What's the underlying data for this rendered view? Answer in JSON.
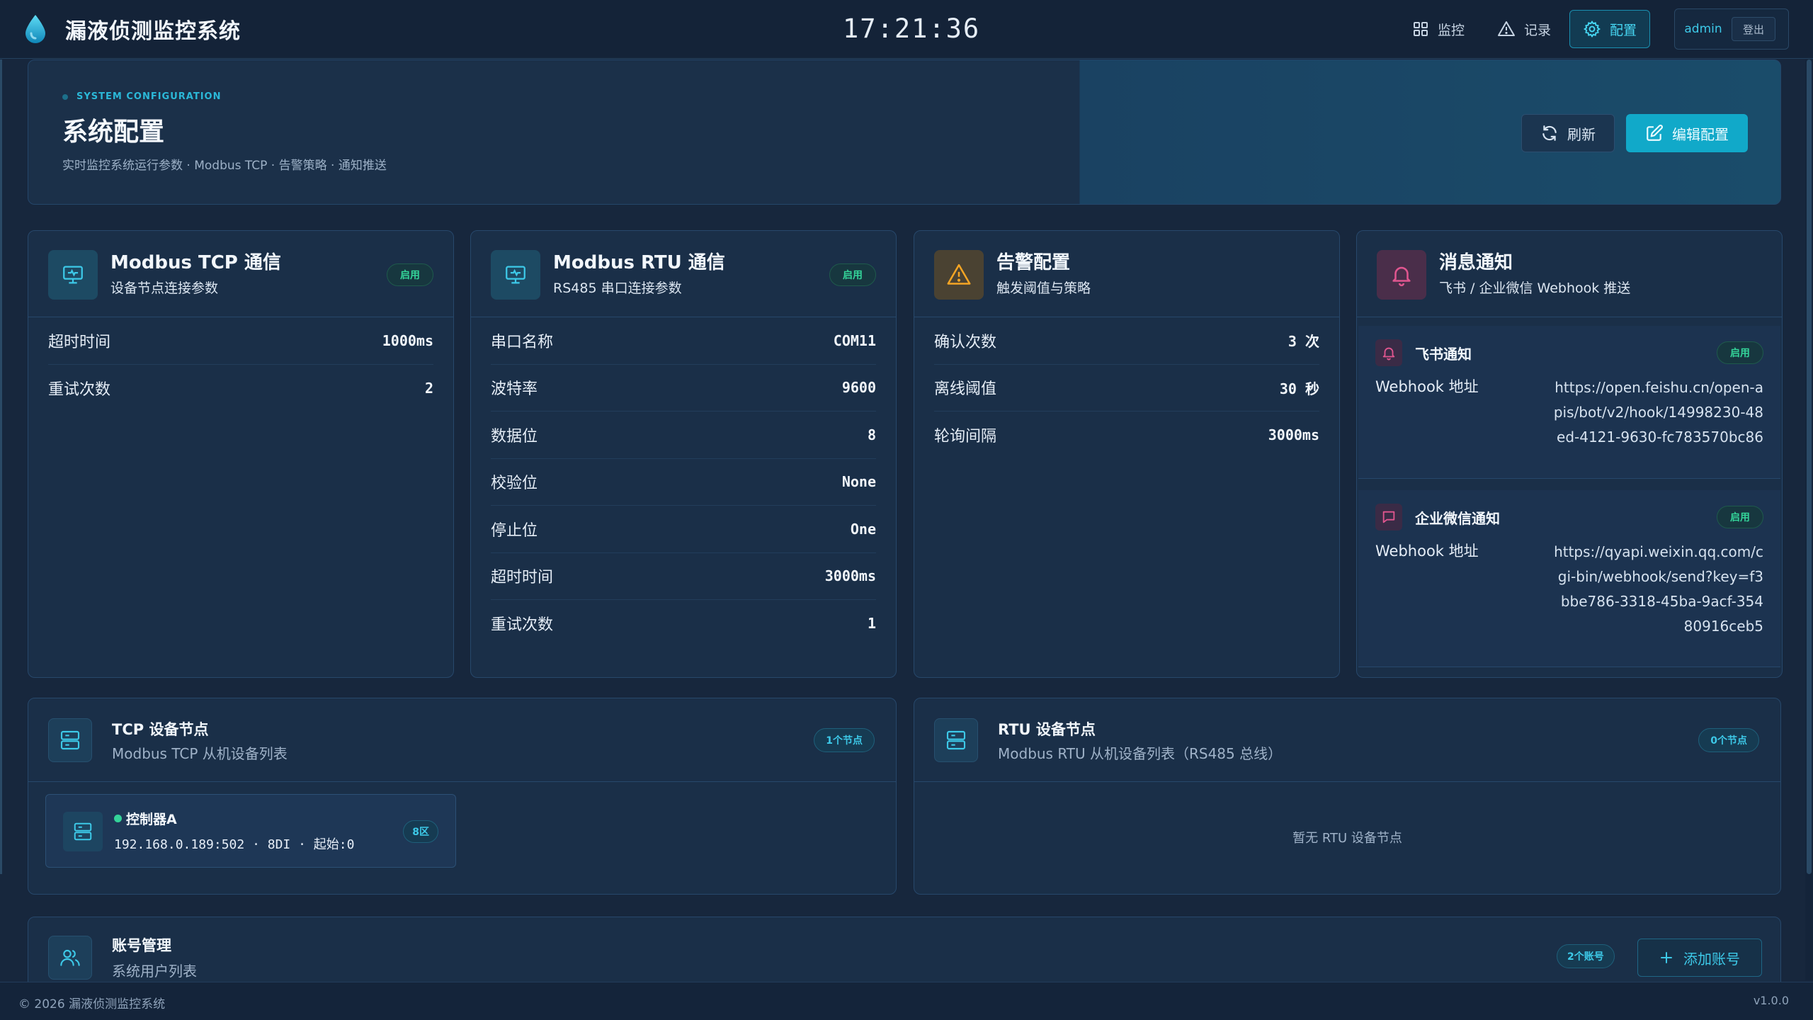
{
  "app": {
    "title": "漏液侦测监控系统",
    "clock": "17:21:36"
  },
  "nav": {
    "monitor": "监控",
    "record": "记录",
    "config": "配置",
    "user": "admin",
    "logout": "登出"
  },
  "header": {
    "kicker": "SYSTEM CONFIGURATION",
    "title": "系统配置",
    "subtitle": "实时监控系统运行参数 · Modbus TCP · 告警策略 · 通知推送",
    "refresh": "刷新",
    "edit": "编辑配置"
  },
  "tcp_card": {
    "title": "Modbus TCP 通信",
    "subtitle": "设备节点连接参数",
    "badge": "启用",
    "rows": [
      {
        "label": "超时时间",
        "value": "1000ms"
      },
      {
        "label": "重试次数",
        "value": "2"
      }
    ]
  },
  "rtu_card": {
    "title": "Modbus RTU 通信",
    "subtitle": "RS485 串口连接参数",
    "badge": "启用",
    "rows": [
      {
        "label": "串口名称",
        "value": "COM11"
      },
      {
        "label": "波特率",
        "value": "9600"
      },
      {
        "label": "数据位",
        "value": "8"
      },
      {
        "label": "校验位",
        "value": "None"
      },
      {
        "label": "停止位",
        "value": "One"
      },
      {
        "label": "超时时间",
        "value": "3000ms"
      },
      {
        "label": "重试次数",
        "value": "1"
      }
    ]
  },
  "alarm_card": {
    "title": "告警配置",
    "subtitle": "触发阈值与策略",
    "rows": [
      {
        "label": "确认次数",
        "value": "3 次"
      },
      {
        "label": "离线阈值",
        "value": "30 秒"
      },
      {
        "label": "轮询间隔",
        "value": "3000ms"
      }
    ]
  },
  "notify_card": {
    "title": "消息通知",
    "subtitle": "飞书 / 企业微信 Webhook 推送",
    "feishu": {
      "title": "飞书通知",
      "badge": "启用",
      "label": "Webhook 地址",
      "url": "https://open.feishu.cn/open-apis/bot/v2/hook/14998230-48ed-4121-9630-fc783570bc86"
    },
    "wecom": {
      "title": "企业微信通知",
      "badge": "启用",
      "label": "Webhook 地址",
      "url": "https://qyapi.weixin.qq.com/cgi-bin/webhook/send?key=f3bbe786-3318-45ba-9acf-35480916ceb5"
    }
  },
  "tcp_nodes": {
    "title": "TCP 设备节点",
    "subtitle": "Modbus TCP 从机设备列表",
    "badge": "1个节点",
    "device": {
      "name": "控制器A",
      "detail": "192.168.0.189:502 · 8DI · 起始:0",
      "zone": "8区"
    }
  },
  "rtu_nodes": {
    "title": "RTU 设备节点",
    "subtitle": "Modbus RTU 从机设备列表（RS485 总线）",
    "badge": "0个节点",
    "empty": "暂无 RTU 设备节点"
  },
  "accounts": {
    "title": "账号管理",
    "subtitle": "系统用户列表",
    "badge": "2个账号",
    "add": "添加账号"
  },
  "footer": {
    "copyright": "© 2026 漏液侦测监控系统",
    "version": "v1.0.0"
  },
  "colors": {
    "accent": "#11a9c9",
    "success": "#34d399",
    "warning": "#f5a524",
    "pink": "#e0568f",
    "background": "#17273d"
  },
  "icons": {
    "brand": "water-drop-icon",
    "monitor": "grid-icon",
    "record": "warning-triangle-icon",
    "config": "gear-icon",
    "refresh": "refresh-icon",
    "edit": "edit-icon",
    "tcp": "monitor-icon",
    "rtu": "monitor-icon",
    "alarm": "warning-triangle-icon",
    "notify": "bell-icon",
    "wecom": "chat-icon",
    "server": "server-icon",
    "users": "users-icon",
    "add": "plus-icon"
  }
}
